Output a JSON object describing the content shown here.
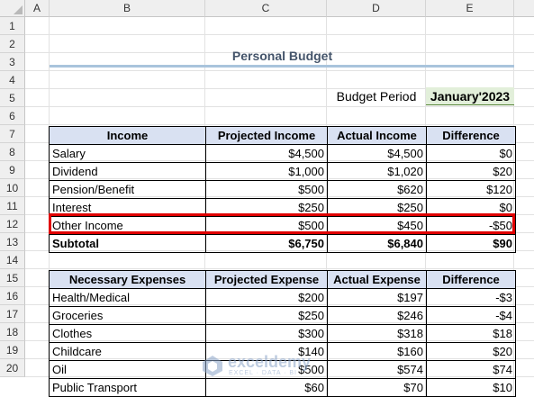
{
  "columns": [
    "A",
    "B",
    "C",
    "D",
    "E"
  ],
  "rows": [
    "1",
    "2",
    "3",
    "4",
    "5",
    "6",
    "7",
    "8",
    "9",
    "10",
    "11",
    "12",
    "13",
    "14",
    "15",
    "16",
    "17",
    "18",
    "19",
    "20"
  ],
  "sheet": {
    "title": "Personal Budget",
    "budget_period_label": "Budget Period",
    "budget_period_value": "January'2023"
  },
  "income": {
    "headers": [
      "Income",
      "Projected Income",
      "Actual Income",
      "Difference"
    ],
    "rows": [
      {
        "name": "Salary",
        "projected": "$4,500",
        "actual": "$4,500",
        "diff": "$0"
      },
      {
        "name": "Dividend",
        "projected": "$1,000",
        "actual": "$1,020",
        "diff": "$20"
      },
      {
        "name": "Pension/Benefit",
        "projected": "$500",
        "actual": "$620",
        "diff": "$120"
      },
      {
        "name": "Interest",
        "projected": "$250",
        "actual": "$250",
        "diff": "$0"
      },
      {
        "name": "Other Income",
        "projected": "$500",
        "actual": "$450",
        "diff": "-$50"
      }
    ],
    "subtotal": {
      "name": "Subtotal",
      "projected": "$6,750",
      "actual": "$6,840",
      "diff": "$90"
    }
  },
  "expenses": {
    "headers": [
      "Necessary Expenses",
      "Projected Expense",
      "Actual Expense",
      "Difference"
    ],
    "rows": [
      {
        "name": "Health/Medical",
        "projected": "$200",
        "actual": "$197",
        "diff": "-$3"
      },
      {
        "name": "Groceries",
        "projected": "$250",
        "actual": "$246",
        "diff": "-$4"
      },
      {
        "name": "Clothes",
        "projected": "$300",
        "actual": "$318",
        "diff": "$18"
      },
      {
        "name": "Childcare",
        "projected": "$140",
        "actual": "$160",
        "diff": "$20"
      },
      {
        "name": "Oil",
        "projected": "$500",
        "actual": "$574",
        "diff": "$74"
      },
      {
        "name": "Public Transport",
        "projected": "$60",
        "actual": "$70",
        "diff": "$10"
      }
    ]
  },
  "watermark": {
    "name": "exceldemy",
    "sub": "EXCEL · DATA · BI"
  },
  "colors": {
    "header_fill": "#d9e1f2",
    "highlight": "#e00000",
    "period_fill": "#e2efda",
    "title": "#44546a"
  }
}
